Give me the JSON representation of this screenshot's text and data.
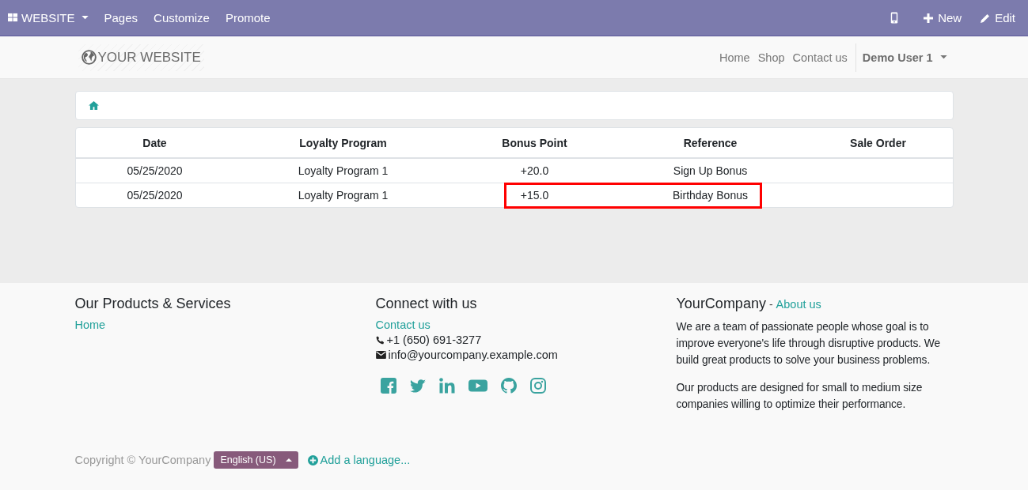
{
  "admin_bar": {
    "app_menu": "WEBSITE",
    "menu": [
      "Pages",
      "Customize",
      "Promote"
    ],
    "new": "New",
    "edit": "Edit"
  },
  "header": {
    "logo": "YOUR WEBSITE",
    "nav": [
      "Home",
      "Shop",
      "Contact us"
    ],
    "user": "Demo User 1"
  },
  "table": {
    "columns": [
      "Date",
      "Loyalty Program",
      "Bonus Point",
      "Reference",
      "Sale Order"
    ],
    "rows": [
      {
        "cells": [
          "05/25/2020",
          "Loyalty Program 1",
          "+20.0",
          "Sign Up Bonus",
          ""
        ],
        "highlighted": false
      },
      {
        "cells": [
          "05/25/2020",
          "Loyalty Program 1",
          "+15.0",
          "Birthday Bonus",
          ""
        ],
        "highlighted": true
      }
    ]
  },
  "footer": {
    "products": {
      "title": "Our Products & Services",
      "links": [
        "Home"
      ]
    },
    "connect": {
      "title": "Connect with us",
      "link": "Contact us",
      "phone": "+1 (650) 691-3277",
      "email": "info@yourcompany.example.com"
    },
    "company": {
      "title": "YourCompany",
      "separator": "-",
      "link": "About us",
      "paragraphs": [
        "We are a team of passionate people whose goal is to improve everyone's life through disruptive products. We build great products to solve your business problems.",
        "Our products are designed for small to medium size companies willing to optimize their performance."
      ]
    },
    "copyright": "Copyright © YourCompany",
    "language": "English (US)",
    "add_language": "Add a language..."
  }
}
